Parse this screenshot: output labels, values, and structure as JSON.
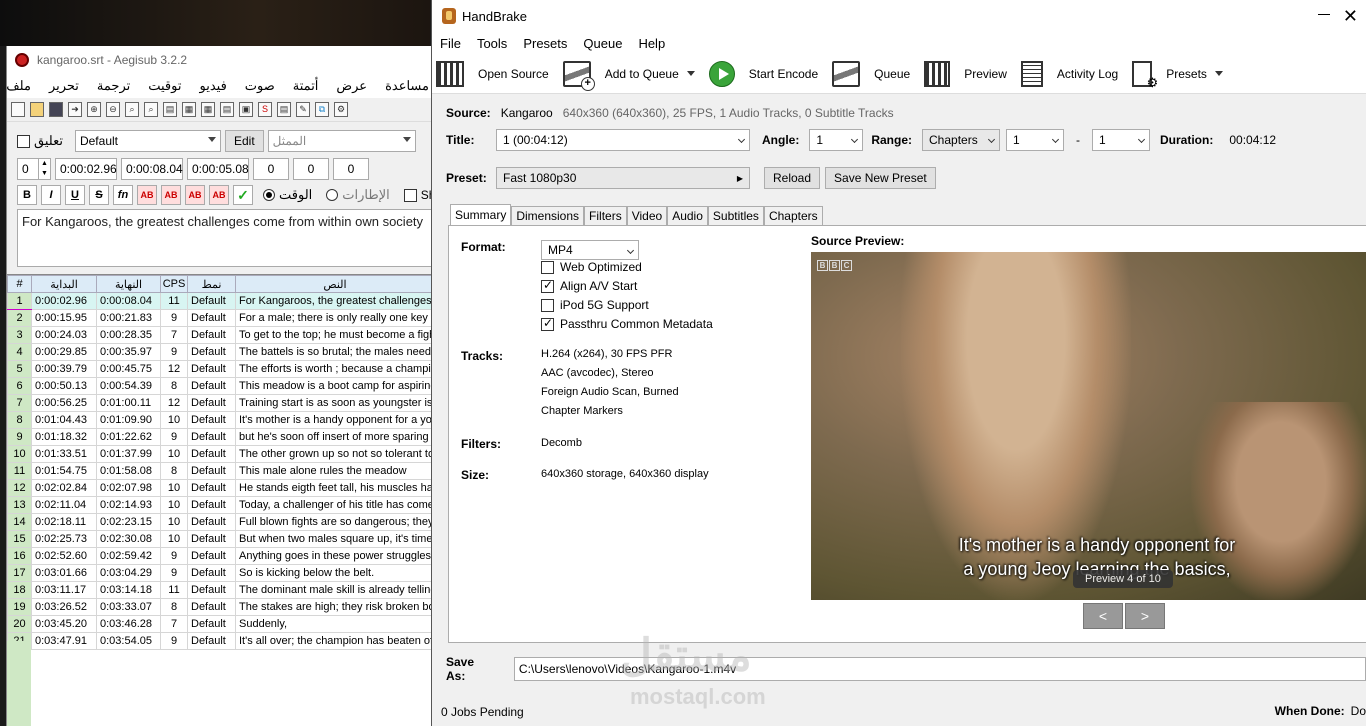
{
  "aegisub": {
    "title": "kangaroo.srt - Aegisub 3.2.2",
    "menu": [
      "ملف",
      "تحرير",
      "ترجمة",
      "توقيت",
      "فيديو",
      "صوت",
      "أتمتة",
      "عرض",
      "مساعدة"
    ],
    "comment_label": "تعليق",
    "style_value": "Default",
    "edit_button": "Edit",
    "actor_placeholder": "الممثل",
    "layer": "0",
    "start_time": "0:00:02.96",
    "end_time": "0:00:08.04",
    "duration": "0:00:05.08",
    "margin_l": "0",
    "margin_r": "0",
    "margin_v": "0",
    "format_buttons": [
      "B",
      "I",
      "U",
      "S",
      "fn",
      "AB",
      "AB",
      "AB",
      "AB"
    ],
    "radio_time": "الوقت",
    "radio_frames": "الإطارات",
    "show_label": "Sh",
    "edit_text": "For Kangaroos, the greatest challenges come from within own society",
    "grid": {
      "headers": [
        "#",
        "البداية",
        "النهاية",
        "CPS",
        "نمط",
        "النص"
      ],
      "rows": [
        [
          "1",
          "0:00:02.96",
          "0:00:08.04",
          "11",
          "Default",
          "For Kangaroos, the greatest challenges"
        ],
        [
          "2",
          "0:00:15.95",
          "0:00:21.83",
          "9",
          "Default",
          "For a male; there is only really one key le"
        ],
        [
          "3",
          "0:00:24.03",
          "0:00:28.35",
          "7",
          "Default",
          "To get to the top; he must become a figh"
        ],
        [
          "4",
          "0:00:29.85",
          "0:00:35.97",
          "9",
          "Default",
          "The battels is so brutal; the males need"
        ],
        [
          "5",
          "0:00:39.79",
          "0:00:45.75",
          "12",
          "Default",
          "The efforts is worth ; because a champio"
        ],
        [
          "6",
          "0:00:50.13",
          "0:00:54.39",
          "8",
          "Default",
          "This meadow is a boot camp for aspiring"
        ],
        [
          "7",
          "0:00:56.25",
          "0:01:00.11",
          "12",
          "Default",
          "Training start is as soon as youngster is"
        ],
        [
          "8",
          "0:01:04.43",
          "0:01:09.90",
          "10",
          "Default",
          "It's mother is a handy opponent for a yo"
        ],
        [
          "9",
          "0:01:18.32",
          "0:01:22.62",
          "9",
          "Default",
          "but he's soon off insert of more sparing"
        ],
        [
          "10",
          "0:01:33.51",
          "0:01:37.99",
          "10",
          "Default",
          "The other grown up so not so tolerant to"
        ],
        [
          "11",
          "0:01:54.75",
          "0:01:58.08",
          "8",
          "Default",
          "This male alone rules the meadow"
        ],
        [
          "12",
          "0:02:02.84",
          "0:02:07.98",
          "10",
          "Default",
          "He stands eigth feet tall, his muscles har"
        ],
        [
          "13",
          "0:02:11.04",
          "0:02:14.93",
          "10",
          "Default",
          "Today, a challenger of his title has come"
        ],
        [
          "14",
          "0:02:18.11",
          "0:02:23.15",
          "10",
          "Default",
          "Full blown fights are so dangerous; they"
        ],
        [
          "15",
          "0:02:25.73",
          "0:02:30.08",
          "10",
          "Default",
          "But when two males square up, it's time"
        ],
        [
          "16",
          "0:02:52.60",
          "0:02:59.42",
          "9",
          "Default",
          "Anything goes in these power struggles"
        ],
        [
          "17",
          "0:03:01.66",
          "0:03:04.29",
          "9",
          "Default",
          "So is kicking below the belt."
        ],
        [
          "18",
          "0:03:11.17",
          "0:03:14.18",
          "11",
          "Default",
          "The dominant male skill is already telling;"
        ],
        [
          "19",
          "0:03:26.52",
          "0:03:33.07",
          "8",
          "Default",
          "The stakes are high; they risk broken bo"
        ],
        [
          "20",
          "0:03:45.20",
          "0:03:46.28",
          "7",
          "Default",
          "Suddenly,"
        ],
        [
          "21",
          "0:03:47.91",
          "0:03:54.05",
          "9",
          "Default",
          "It's all over; the champion has beaten of"
        ]
      ]
    }
  },
  "handbrake": {
    "title": "HandBrake",
    "menu": [
      "File",
      "Tools",
      "Presets",
      "Queue",
      "Help"
    ],
    "toolbar": {
      "open_source": "Open Source",
      "add_to_queue": "Add to Queue",
      "start_encode": "Start Encode",
      "queue": "Queue",
      "preview": "Preview",
      "activity_log": "Activity Log",
      "presets": "Presets"
    },
    "source_label": "Source:",
    "source_name": "Kangaroo",
    "source_info": "640x360 (640x360), 25 FPS, 1 Audio Tracks, 0 Subtitle Tracks",
    "title_label": "Title:",
    "title_value": "1  (00:04:12)",
    "angle_label": "Angle:",
    "angle_value": "1",
    "range_label": "Range:",
    "range_value": "Chapters",
    "range_start": "1",
    "range_sep": "-",
    "range_end": "1",
    "duration_label": "Duration:",
    "duration_value": "00:04:12",
    "preset_label": "Preset:",
    "preset_value": "Fast 1080p30",
    "reload_button": "Reload",
    "save_preset_button": "Save New Preset",
    "tabs": [
      "Summary",
      "Dimensions",
      "Filters",
      "Video",
      "Audio",
      "Subtitles",
      "Chapters"
    ],
    "summary": {
      "format_label": "Format:",
      "format_value": "MP4",
      "checkboxes": [
        {
          "label": "Web Optimized",
          "checked": false
        },
        {
          "label": "Align A/V Start",
          "checked": true
        },
        {
          "label": "iPod 5G Support",
          "checked": false
        },
        {
          "label": "Passthru Common Metadata",
          "checked": true
        }
      ],
      "tracks_label": "Tracks:",
      "tracks": [
        "H.264 (x264), 30 FPS PFR",
        "AAC (avcodec), Stereo",
        "Foreign Audio Scan, Burned",
        "Chapter Markers"
      ],
      "filters_label": "Filters:",
      "filters_value": "Decomb",
      "size_label": "Size:",
      "size_value": "640x360 storage, 640x360 display",
      "source_preview_label": "Source Preview:",
      "subtitle_line1": "It's mother is a handy opponent for",
      "subtitle_line2": "a young Jeoy learning the basics,",
      "preview_badge": "Preview 4 of 10",
      "prev_btn": "<",
      "next_btn": ">"
    },
    "save_as_label": "Save As:",
    "save_as_path": "C:\\Users\\lenovo\\Videos\\Kangaroo-1.m4v",
    "jobs_pending": "0 Jobs Pending",
    "when_done_label": "When Done:",
    "when_done_value": "Do"
  },
  "watermark": {
    "arabic": "مستقل",
    "latin": "mostaql.com"
  }
}
